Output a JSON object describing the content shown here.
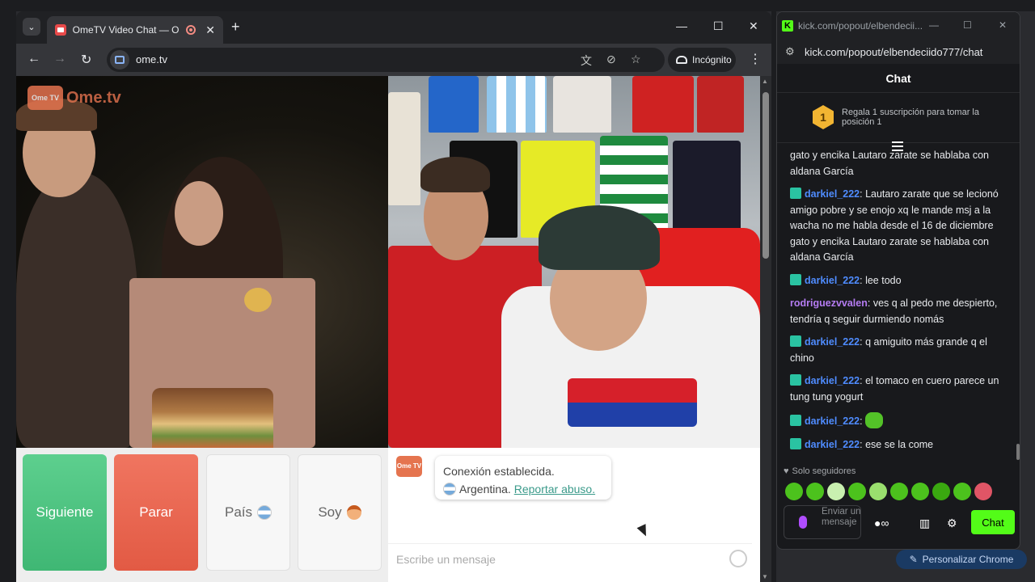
{
  "browser": {
    "tab_title": "OmeTV Video Chat — Ome",
    "url": "ome.tv",
    "incognito_label": "Incógnito",
    "icons": [
      "tab-search-icon",
      "new-tab-icon",
      "back-icon",
      "forward-icon",
      "reload-icon",
      "translate-icon",
      "eye-off-icon",
      "bookmark-star-icon",
      "incognito-icon",
      "menu-icon"
    ]
  },
  "ome": {
    "logo_badge": "Ome TV",
    "logo_text": "Ome.tv",
    "buttons": {
      "next": "Siguiente",
      "stop": "Parar",
      "country": "País",
      "gender": "Soy"
    },
    "system_message": {
      "line1": "Conexión establecida.",
      "country": "Argentina.",
      "report_link": "Reportar abuso."
    },
    "input_placeholder": "Escribe un mensaje",
    "colors": {
      "next": "#4cc47f",
      "stop": "#e8644d",
      "link": "#3a9a8a",
      "brand": "#e5744f"
    }
  },
  "kick": {
    "window_title": "kick.com/popout/elbendeciі...",
    "url": "kick.com/popout/elbendeciido777/chat",
    "header": "Chat",
    "gift_rank": "1",
    "gift_text": "Regala 1 suscripción para tomar la posición 1",
    "messages": [
      {
        "user": "",
        "text": "gato y encika Lautaro zarate se hablaba con aldana García",
        "color": "none",
        "badge": false
      },
      {
        "user": "darkiel_222",
        "text": "Lautaro zarate que se lecionó amigo pobre y se enojo xq le mande msj a la wacha no me habla desde el 16 de diciembre gato y encika Lautaro zarate se hablaba con aldana García",
        "color": "blue",
        "badge": true
      },
      {
        "user": "darkiel_222",
        "text": "lee todo",
        "color": "blue",
        "badge": true
      },
      {
        "user": "rodriguezvvalen",
        "text": "ves q al pedo me despierto, tendría q seguir durmiendo nomás",
        "color": "purple",
        "badge": false
      },
      {
        "user": "darkiel_222",
        "text": "q amiguito más grande q el chino",
        "color": "blue",
        "badge": true
      },
      {
        "user": "darkiel_222",
        "text": "el tomaco en cuero parece un tung tung yogurt",
        "color": "blue",
        "badge": true
      },
      {
        "user": "darkiel_222",
        "text": "",
        "color": "blue",
        "badge": true,
        "emote": true
      },
      {
        "user": "darkiel_222",
        "text": "ese se la come",
        "color": "blue",
        "badge": true
      }
    ],
    "followers_only": "Solo seguidores",
    "input_placeholder": "Enviar un mensaje",
    "chat_button": "Chat",
    "colors": {
      "accent": "#53fc18",
      "user_blue": "#4f8cff",
      "user_purple": "#b57cf2"
    }
  },
  "desktop": {
    "personalize_label": "Personalizar Chrome"
  }
}
